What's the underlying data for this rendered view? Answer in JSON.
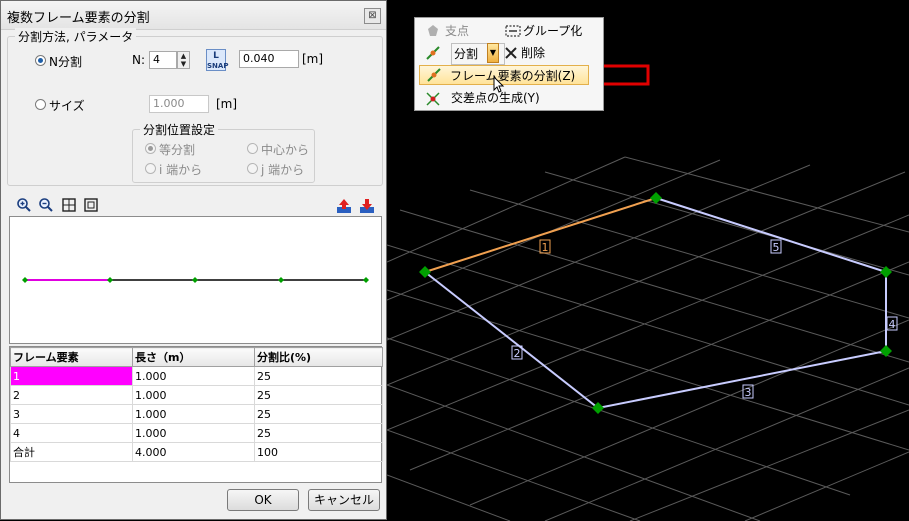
{
  "dialog": {
    "title": "複数フレーム要素の分割",
    "close_symbol": "⊠",
    "method_group": "分割方法, パラメータ",
    "n_split_label": "N分割",
    "n_label": "N:",
    "n_value": "4",
    "snap_label_top": "L",
    "snap_label_bottom": "SNAP",
    "length_value": "0.040",
    "unit": "[m]",
    "size_label": "サイズ",
    "size_value": "1.000",
    "size_unit": "[m]",
    "position_group": "分割位置設定",
    "equal_label": "等分割",
    "center_label": "中心から",
    "i_end_label": "i 端から",
    "j_end_label": "j 端から",
    "table": {
      "headers": [
        "フレーム要素",
        "長さ（m）",
        "分割比(%)"
      ],
      "rows": [
        [
          "1",
          "1.000",
          "25"
        ],
        [
          "2",
          "1.000",
          "25"
        ],
        [
          "3",
          "1.000",
          "25"
        ],
        [
          "4",
          "1.000",
          "25"
        ],
        [
          "合計",
          "4.000",
          "100"
        ]
      ]
    },
    "ok_label": "OK",
    "cancel_label": "キャンセル"
  },
  "menu": {
    "support_label": "支点",
    "group_label": "グループ化",
    "split_label": "分割",
    "delete_label": "削除",
    "frame_split_label": "フレーム要素の分割(Z)",
    "intersection_label": "交差点の生成(Y)"
  },
  "model": {
    "member_labels": [
      "1",
      "2",
      "3",
      "4",
      "5"
    ],
    "colors": {
      "selected_member": "#f0a050",
      "member": "#c8ccff",
      "node": "#00a000",
      "grid": "#5a5a5a",
      "arrow": "#e00000",
      "split_preview": "#e000e0"
    }
  }
}
